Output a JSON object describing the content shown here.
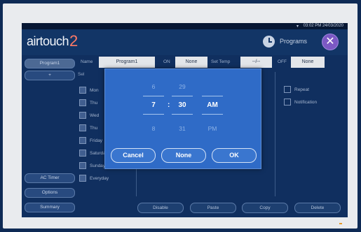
{
  "status": {
    "time_date": "03:02 PM 24/03/2020"
  },
  "header": {
    "logo_text": "airtouch",
    "logo_suffix": "2",
    "programs_label": "Programs"
  },
  "sidebar": {
    "program_label": "Program1",
    "add_label": "+",
    "ac_timer_label": "AC Timer",
    "options_label": "Options",
    "summary_label": "Summary"
  },
  "toprow": {
    "name_label": "Name",
    "name_value": "Program1",
    "on_label": "ON",
    "on_value": "None",
    "set_temp_label": "Set Temp",
    "set_temp_value": "--/--",
    "off_label": "OFF",
    "off_value": "None"
  },
  "days": {
    "title": "Sel",
    "items": [
      "Mon",
      "Thu",
      "Wed",
      "Thu",
      "Friday",
      "Saturday",
      "Sunday",
      "Everyday"
    ]
  },
  "right_checks": [
    "Repeat",
    "Notification"
  ],
  "bottom": {
    "disable_label": "Disable",
    "paste_label": "Paste",
    "copy_label": "Copy",
    "delete_label": "Delete"
  },
  "picker": {
    "hour": {
      "prev": "6",
      "selected": "7",
      "next": "8"
    },
    "minute": {
      "prev": "29",
      "selected": "30",
      "next": "31"
    },
    "ampm": {
      "selected": "AM",
      "next": "PM"
    },
    "separator": ":"
  },
  "dialog": {
    "cancel_label": "Cancel",
    "none_label": "None",
    "ok_label": "OK"
  },
  "colors": {
    "screen_bg": "#102f5f",
    "dialog_bg": "#2f6bc7",
    "close_button": "#7b58c4",
    "accent_logo": "#ff7a66"
  }
}
